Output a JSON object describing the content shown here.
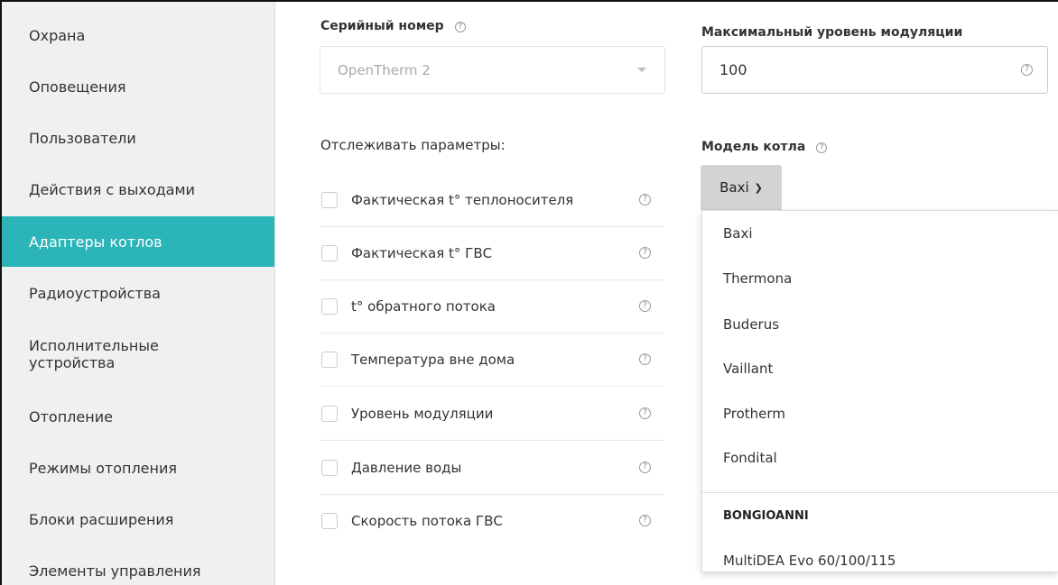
{
  "sidebar": {
    "items": [
      {
        "label": "Охрана"
      },
      {
        "label": "Оповещения"
      },
      {
        "label": "Пользователи"
      },
      {
        "label": "Действия с выходами"
      },
      {
        "label": "Адаптеры котлов"
      },
      {
        "label": "Радиоустройства"
      },
      {
        "label": "Исполнительные устройства"
      },
      {
        "label": "Отопление"
      },
      {
        "label": "Режимы отопления"
      },
      {
        "label": "Блоки расширения"
      },
      {
        "label": "Элементы управления"
      }
    ],
    "active_index": 4
  },
  "serial": {
    "label": "Серийный номер",
    "value": "OpenTherm 2",
    "help": "?"
  },
  "max_modulation": {
    "label": "Максимальный уровень модуляции",
    "value": "100",
    "help": "?"
  },
  "params": {
    "title": "Отслеживать параметры:",
    "items": [
      {
        "label": "Фактическая t° теплоносителя",
        "help": "?"
      },
      {
        "label": "Фактическая t° ГВС",
        "help": "?"
      },
      {
        "label": "t° обратного потока",
        "help": "?"
      },
      {
        "label": "Температура вне дома",
        "help": "?"
      },
      {
        "label": "Уровень модуляции",
        "help": "?"
      },
      {
        "label": "Давление воды",
        "help": "?"
      },
      {
        "label": "Скорость потока ГВС",
        "help": "?"
      }
    ]
  },
  "boiler_model": {
    "label": "Модель котла",
    "help": "?",
    "selected": "Baxi",
    "options": [
      "Baxi",
      "Thermona",
      "Buderus",
      "Vaillant",
      "Protherm",
      "Fondital"
    ],
    "group_header": "BONGIOANNI",
    "group_options": [
      "MultiDEA Evo 60/100/115"
    ]
  },
  "colors": {
    "accent": "#2bb5b8",
    "sidebar_bg": "#f0f0f0"
  }
}
